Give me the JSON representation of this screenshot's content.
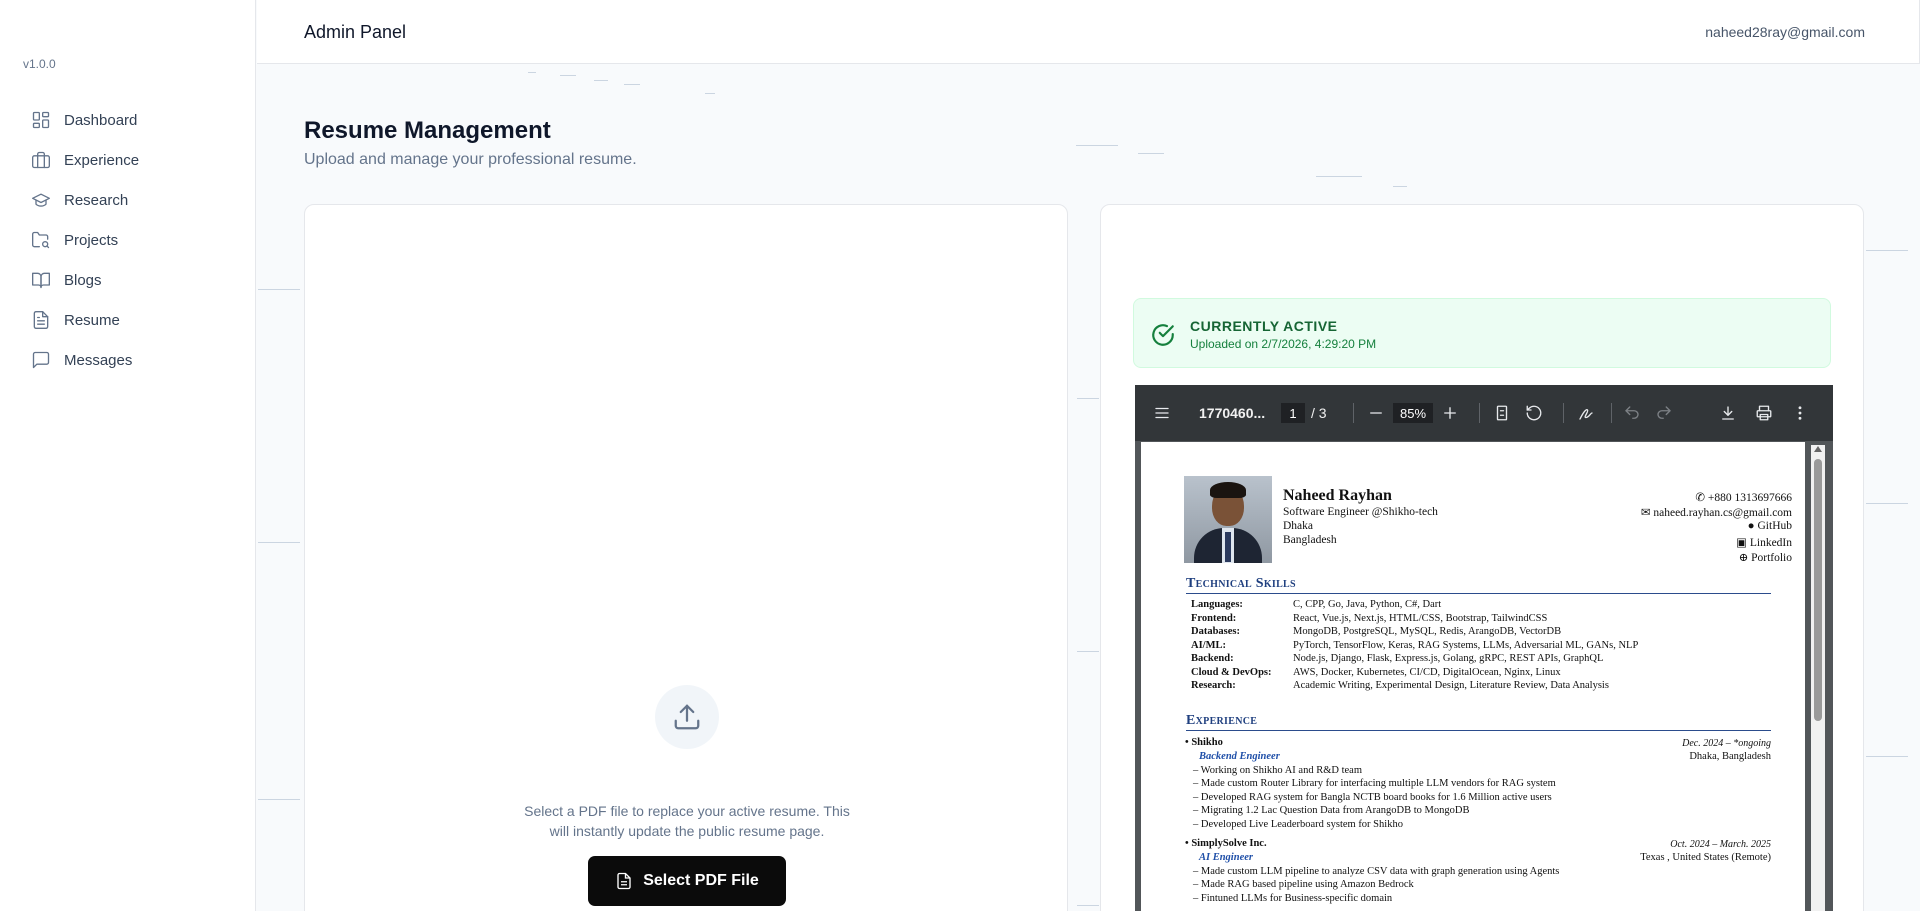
{
  "sidebar": {
    "version": "v1.0.0",
    "items": [
      {
        "label": "Dashboard",
        "icon": "dashboard-icon"
      },
      {
        "label": "Experience",
        "icon": "briefcase-icon"
      },
      {
        "label": "Research",
        "icon": "graduation-cap-icon"
      },
      {
        "label": "Projects",
        "icon": "folder-search-icon"
      },
      {
        "label": "Blogs",
        "icon": "book-open-icon"
      },
      {
        "label": "Resume",
        "icon": "file-text-icon"
      },
      {
        "label": "Messages",
        "icon": "message-square-icon"
      }
    ]
  },
  "header": {
    "title": "Admin Panel",
    "email": "naheed28ray@gmail.com"
  },
  "main": {
    "title": "Resume Management",
    "subtitle": "Upload and manage your professional resume.",
    "upload": {
      "description": "Select a PDF file to replace your active resume. This will instantly update the public resume page.",
      "button_label": "Select PDF File"
    },
    "active": {
      "title": "CURRENTLY ACTIVE",
      "uploaded": "Uploaded on 2/7/2026, 4:29:20 PM"
    },
    "viewer": {
      "filename": "1770460...",
      "current_page": "1",
      "page_total": "/ 3",
      "zoom": "85%",
      "resume": {
        "name": "Naheed Rayhan",
        "tagline": "Software Engineer @Shikho-tech",
        "city": "Dhaka",
        "country": "Bangladesh",
        "phone": "+880 1313697666",
        "email": "naheed.rayhan.cs@gmail.com",
        "github": "GitHub",
        "linkedin": "LinkedIn",
        "portfolio": "Portfolio",
        "skills_heading": "Technical Skills",
        "skills": [
          {
            "label": "Languages:",
            "value": "C, CPP, Go, Java, Python, C#, Dart"
          },
          {
            "label": "Frontend:",
            "value": "React, Vue.js, Next.js, HTML/CSS, Bootstrap, TailwindCSS"
          },
          {
            "label": "Databases:",
            "value": "MongoDB, PostgreSQL, MySQL, Redis, ArangoDB, VectorDB"
          },
          {
            "label": "AI/ML:",
            "value": "PyTorch, TensorFlow, Keras, RAG Systems, LLMs, Adversarial ML, GANs, NLP"
          },
          {
            "label": "Backend:",
            "value": "Node.js, Django, Flask, Express.js, Golang, gRPC, REST APIs, GraphQL"
          },
          {
            "label": "Cloud & DevOps:",
            "value": "AWS, Docker, Kubernetes, CI/CD, DigitalOcean, Nginx, Linux"
          },
          {
            "label": "Research:",
            "value": "Academic Writing, Experimental Design, Literature Review, Data Analysis"
          }
        ],
        "experience_heading": "Experience",
        "jobs": [
          {
            "company": "Shikho",
            "date": "Dec. 2024 – *ongoing",
            "role": "Backend Engineer",
            "location": "Dhaka, Bangladesh",
            "bullets": [
              "– Working on Shikho AI and R&D team",
              "– Made custom Router Library for interfacing multiple LLM vendors for RAG system",
              "– Developed RAG system for Bangla NCTB board books for 1.6 Million active users",
              "– Migrating 1.2 Lac Question Data from ArangoDB to MongoDB",
              "– Developed Live Leaderboard system for Shikho"
            ]
          },
          {
            "company": "SimplySolve Inc.",
            "date": "Oct. 2024 – March. 2025",
            "role": "AI Engineer",
            "location": "Texas , United States (Remote)",
            "bullets": [
              "– Made custom LLM pipeline to analyze CSV data with graph generation using Agents",
              "– Made RAG based pipeline using Amazon Bedrock",
              "– Fintuned LLMs for Business-specific domain"
            ]
          }
        ]
      }
    }
  }
}
